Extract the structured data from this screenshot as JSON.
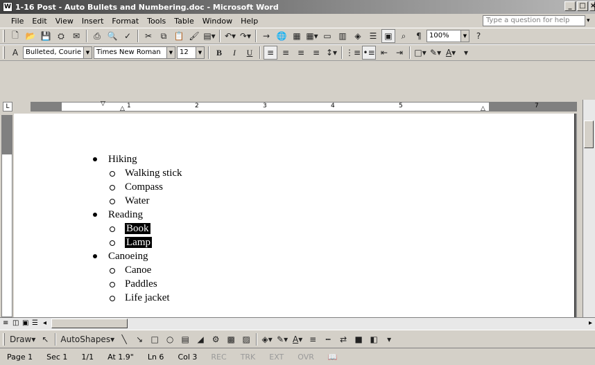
{
  "window": {
    "title": "1-16 Post - Auto Bullets and Numbering.doc - Microsoft Word",
    "icon": "word-doc-icon"
  },
  "menubar": {
    "items": [
      "File",
      "Edit",
      "View",
      "Insert",
      "Format",
      "Tools",
      "Table",
      "Window",
      "Help"
    ],
    "ask_placeholder": "Type a question for help"
  },
  "toolbar_standard": {
    "zoom": "100%",
    "pilcrow": "¶",
    "help": "?"
  },
  "toolbar_formatting": {
    "style": "Bulleted, Courie",
    "font": "Times New Roman",
    "size": "12",
    "bold": "B",
    "italic": "I",
    "underline": "U"
  },
  "ruler": {
    "marks": [
      "1",
      "2",
      "3",
      "4",
      "5",
      "7"
    ]
  },
  "document": {
    "list": [
      {
        "text": "Hiking",
        "children": [
          {
            "text": "Walking stick"
          },
          {
            "text": "Compass"
          },
          {
            "text": "Water"
          }
        ]
      },
      {
        "text": "Reading",
        "children": [
          {
            "text": "Book",
            "selected": true
          },
          {
            "text": "Lamp",
            "selected": true
          }
        ]
      },
      {
        "text": "Canoeing",
        "children": [
          {
            "text": "Canoe"
          },
          {
            "text": "Paddles"
          },
          {
            "text": "Life jacket"
          }
        ]
      }
    ]
  },
  "drawbar": {
    "draw": "Draw",
    "autoshapes": "AutoShapes"
  },
  "statusbar": {
    "page": "Page 1",
    "sec": "Sec 1",
    "pages": "1/1",
    "at": "At 1.9\"",
    "ln": "Ln 6",
    "col": "Col 3",
    "rec": "REC",
    "trk": "TRK",
    "ext": "EXT",
    "ovr": "OVR"
  }
}
